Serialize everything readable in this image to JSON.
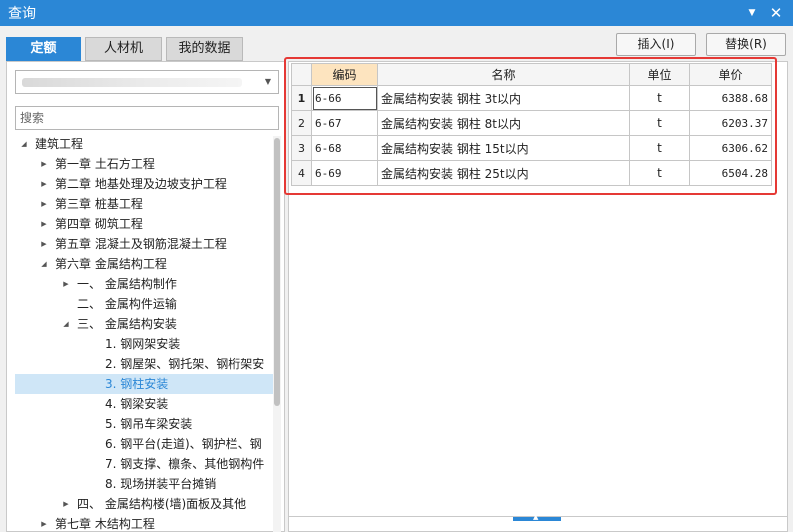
{
  "window": {
    "title": "查询",
    "pin_glyph": "▼",
    "close_glyph": "✕"
  },
  "tabs": [
    {
      "label": "定额",
      "active": true
    },
    {
      "label": "人材机",
      "active": false
    },
    {
      "label": "我的数据",
      "active": false
    }
  ],
  "actions": {
    "insert_label": "插入(I)",
    "replace_label": "替换(R)"
  },
  "search": {
    "placeholder": "搜索"
  },
  "tree": [
    {
      "label": "建筑工程",
      "state": "expanded",
      "level": 0
    },
    {
      "label": "第一章  土石方工程",
      "state": "collapsed",
      "level": 1
    },
    {
      "label": "第二章  地基处理及边坡支护工程",
      "state": "collapsed",
      "level": 1
    },
    {
      "label": "第三章  桩基工程",
      "state": "collapsed",
      "level": 1
    },
    {
      "label": "第四章  砌筑工程",
      "state": "collapsed",
      "level": 1
    },
    {
      "label": "第五章  混凝土及钢筋混凝土工程",
      "state": "collapsed",
      "level": 1
    },
    {
      "label": "第六章  金属结构工程",
      "state": "expanded",
      "level": 1
    },
    {
      "label": "一、  金属结构制作",
      "state": "collapsed",
      "level": 2
    },
    {
      "label": "二、  金属构件运输",
      "state": "none",
      "level": 2
    },
    {
      "label": "三、  金属结构安装",
      "state": "expanded",
      "level": 2
    },
    {
      "label": "1.  钢网架安装",
      "state": "none",
      "level": 3
    },
    {
      "label": "2.  钢屋架、钢托架、钢桁架安",
      "state": "none",
      "level": 3
    },
    {
      "label": "3.  钢柱安装",
      "state": "none",
      "level": 3,
      "selected": true
    },
    {
      "label": "4.  钢梁安装",
      "state": "none",
      "level": 3
    },
    {
      "label": "5.  钢吊车梁安装",
      "state": "none",
      "level": 3
    },
    {
      "label": "6.  钢平台(走道)、钢护栏、钢",
      "state": "none",
      "level": 3
    },
    {
      "label": "7.  钢支撑、檩条、其他钢构件",
      "state": "none",
      "level": 3
    },
    {
      "label": "8.  现场拼装平台摊销",
      "state": "none",
      "level": 3
    },
    {
      "label": "四、  金属结构楼(墙)面板及其他",
      "state": "collapsed",
      "level": 2
    },
    {
      "label": "第七章  木结构工程",
      "state": "collapsed",
      "level": 1
    }
  ],
  "table": {
    "headers": {
      "code": "编码",
      "name": "名称",
      "unit": "单位",
      "price": "单价"
    },
    "rows": [
      {
        "no": "1",
        "code": "6-66",
        "name": "金属结构安装 钢柱 3t以内",
        "unit": "t",
        "price": "6388.68"
      },
      {
        "no": "2",
        "code": "6-67",
        "name": "金属结构安装 钢柱 8t以内",
        "unit": "t",
        "price": "6203.37"
      },
      {
        "no": "3",
        "code": "6-68",
        "name": "金属结构安装 钢柱 15t以内",
        "unit": "t",
        "price": "6306.62"
      },
      {
        "no": "4",
        "code": "6-69",
        "name": "金属结构安装 钢柱 25t以内",
        "unit": "t",
        "price": "6504.28"
      }
    ]
  },
  "colors": {
    "accent": "#2b87d6",
    "highlight_box": "#e53935",
    "sorted_header": "#fde4bf",
    "selected_row": "#cfe6f7"
  }
}
